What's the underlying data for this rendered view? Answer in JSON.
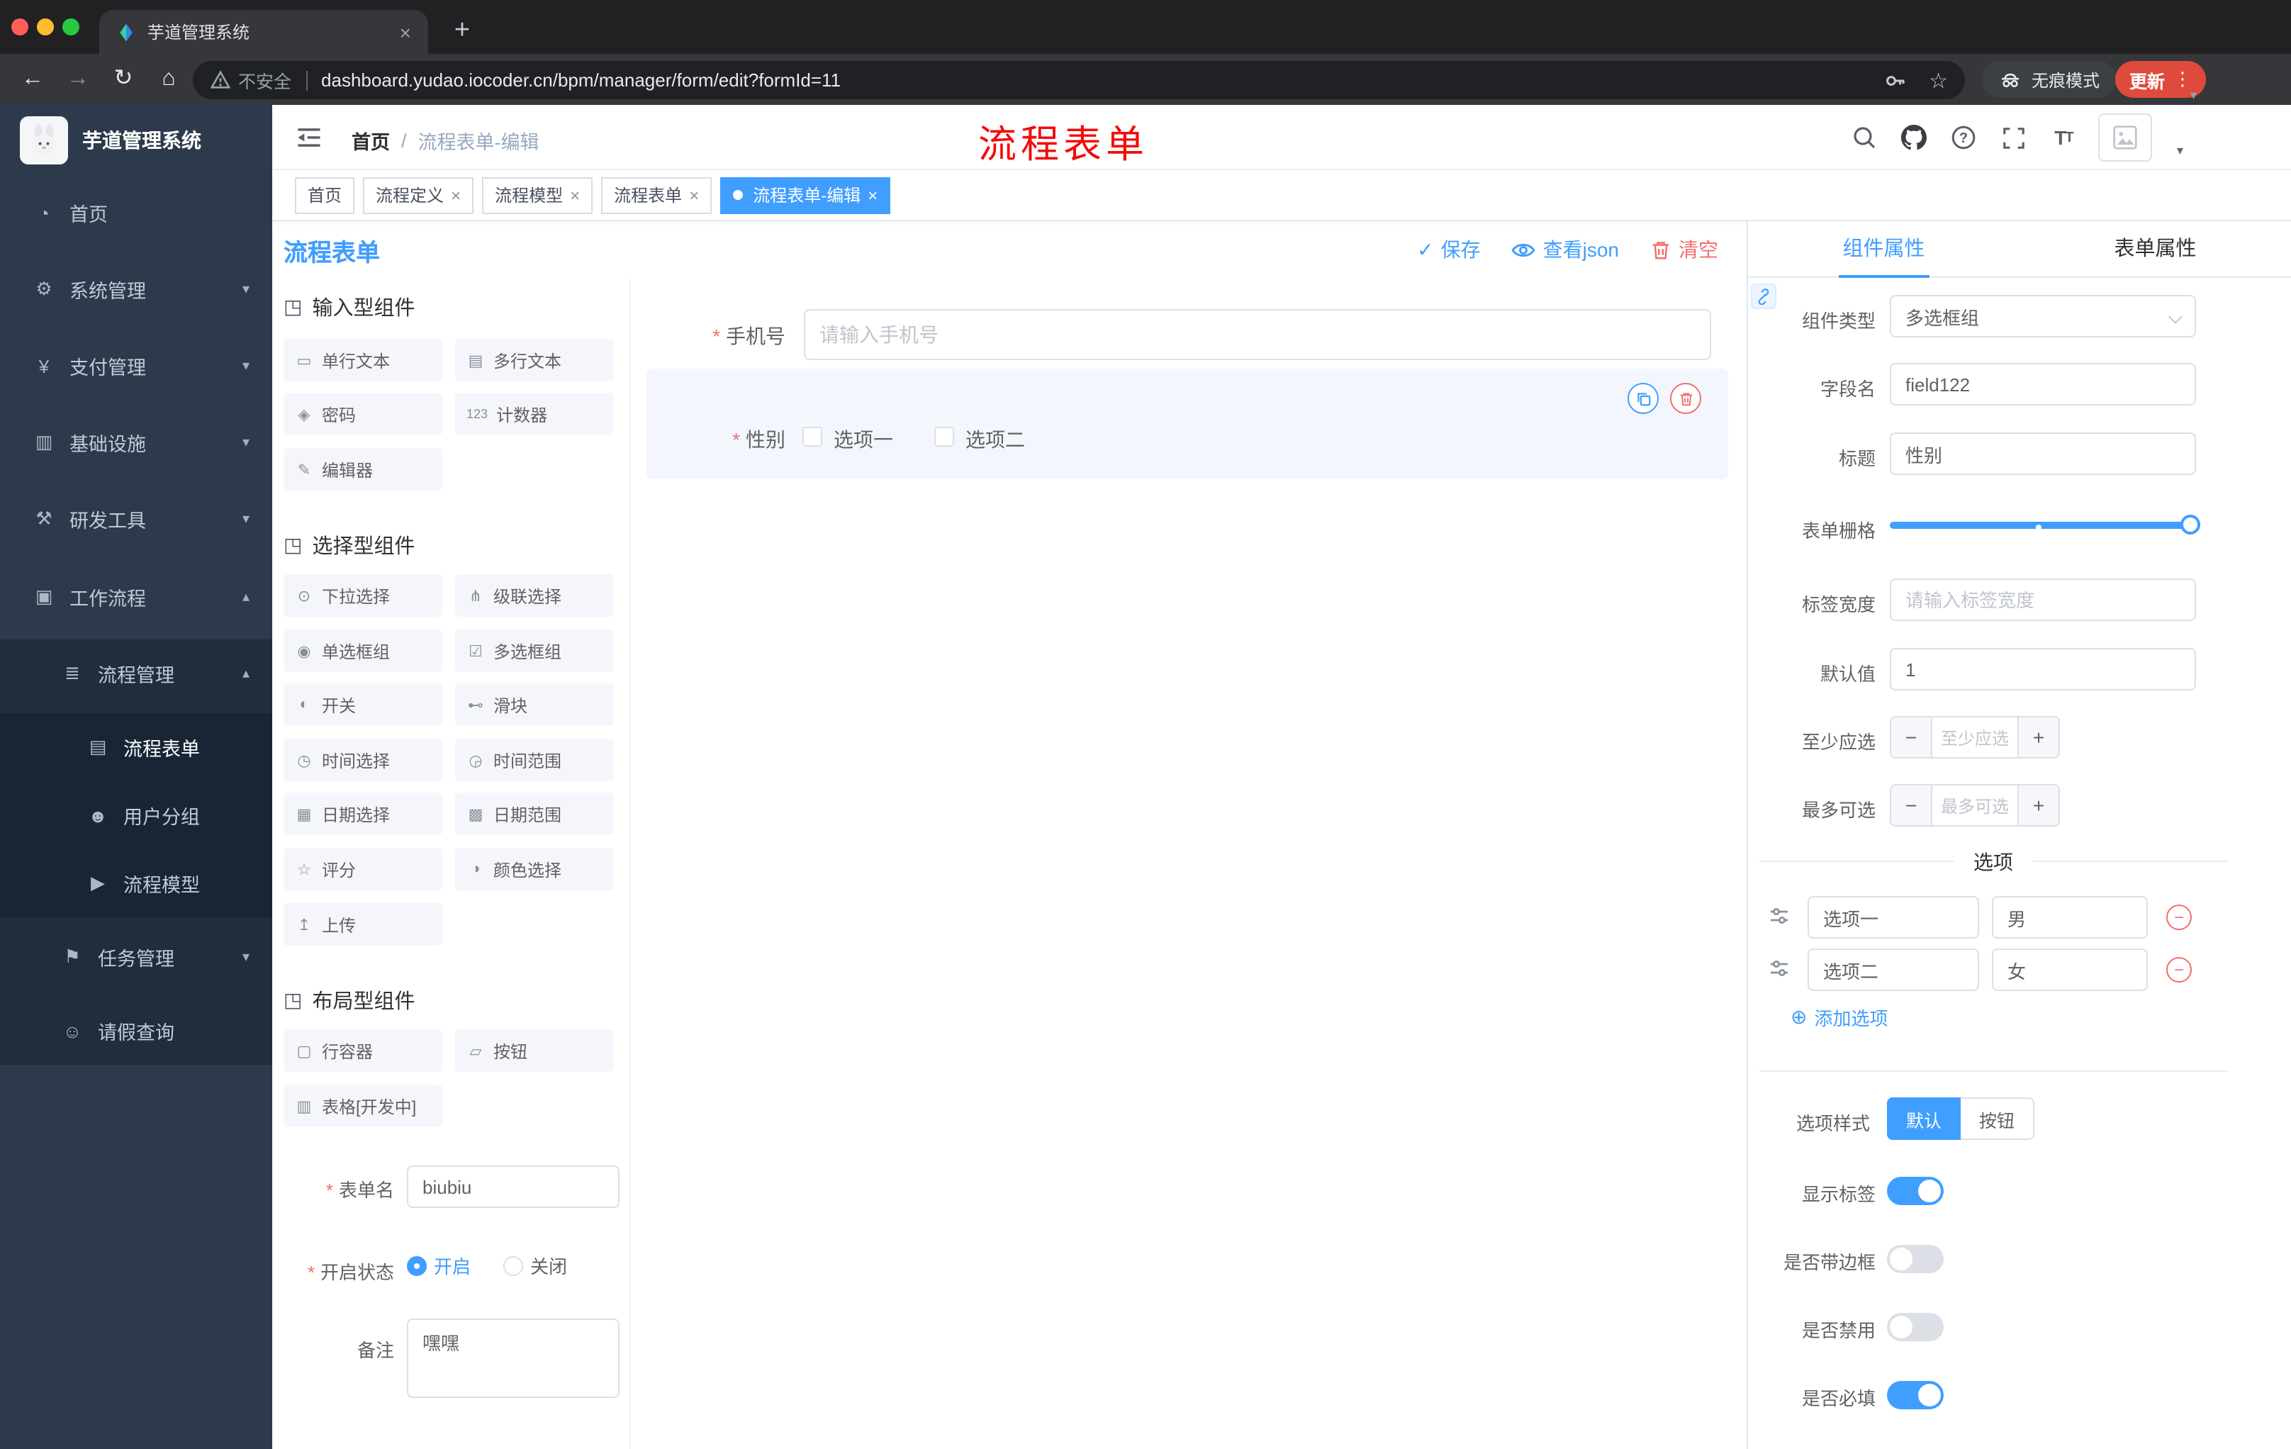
{
  "browser": {
    "tab_title": "芋道管理系统",
    "security_label": "不安全",
    "url": "dashboard.yudao.iocoder.cn/bpm/manager/form/edit?formId=11",
    "incognito_label": "无痕模式",
    "update_label": "更新"
  },
  "annotation": {
    "text": "流程表单"
  },
  "sidebar": {
    "logo_title": "芋道管理系统",
    "items": [
      {
        "label": "首页",
        "icon": "dashboard",
        "level": 1
      },
      {
        "label": "系统管理",
        "icon": "gear",
        "level": 1,
        "chevron": "chevron-down"
      },
      {
        "label": "支付管理",
        "icon": "yen",
        "level": 1,
        "chevron": "chevron-down"
      },
      {
        "label": "基础设施",
        "icon": "infra",
        "level": 1,
        "chevron": "chevron-down"
      },
      {
        "label": "研发工具",
        "icon": "tools",
        "level": 1,
        "chevron": "chevron-down"
      },
      {
        "label": "工作流程",
        "icon": "workflow",
        "level": 1,
        "chevron": "chevron-up"
      },
      {
        "label": "流程管理",
        "icon": "process",
        "level": 2,
        "chevron": "chevron-up"
      },
      {
        "label": "流程表单",
        "icon": "form",
        "level": 3,
        "active": true
      },
      {
        "label": "用户分组",
        "icon": "users",
        "level": 3
      },
      {
        "label": "流程模型",
        "icon": "model",
        "level": 3
      },
      {
        "label": "任务管理",
        "icon": "task",
        "level": 2,
        "chevron": "chevron-down"
      },
      {
        "label": "请假查询",
        "icon": "user",
        "level": 2
      }
    ]
  },
  "header": {
    "breadcrumb": [
      "首页",
      "流程表单-编辑"
    ],
    "breadcrumb_sep": "/"
  },
  "tags": [
    {
      "label": "首页"
    },
    {
      "label": "流程定义",
      "closable": true
    },
    {
      "label": "流程模型",
      "closable": true
    },
    {
      "label": "流程表单",
      "closable": true
    },
    {
      "label": "流程表单-编辑",
      "closable": true,
      "active": true
    }
  ],
  "designer": {
    "title": "流程表单",
    "actions": {
      "save": "保存",
      "view_json": "查看json",
      "clear": "清空"
    },
    "palette": {
      "sections": [
        {
          "title": "输入型组件",
          "icon": "component",
          "items": [
            {
              "label": "单行文本",
              "icon": "text-field"
            },
            {
              "label": "多行文本",
              "icon": "textarea"
            },
            {
              "label": "密码",
              "icon": "lock"
            },
            {
              "label": "计数器",
              "icon": "counter"
            },
            {
              "label": "编辑器",
              "icon": "editor"
            }
          ]
        },
        {
          "title": "选择型组件",
          "icon": "component",
          "items": [
            {
              "label": "下拉选择",
              "icon": "select"
            },
            {
              "label": "级联选择",
              "icon": "cascader"
            },
            {
              "label": "单选框组",
              "icon": "radio-group"
            },
            {
              "label": "多选框组",
              "icon": "checkbox-group"
            },
            {
              "label": "开关",
              "icon": "switch"
            },
            {
              "label": "滑块",
              "icon": "slider"
            },
            {
              "label": "时间选择",
              "icon": "time"
            },
            {
              "label": "时间范围",
              "icon": "time-range"
            },
            {
              "label": "日期选择",
              "icon": "date"
            },
            {
              "label": "日期范围",
              "icon": "date-range"
            },
            {
              "label": "评分",
              "icon": "rate"
            },
            {
              "label": "颜色选择",
              "icon": "color"
            },
            {
              "label": "上传",
              "icon": "upload"
            }
          ]
        },
        {
          "title": "布局型组件",
          "icon": "component",
          "items": [
            {
              "label": "行容器",
              "icon": "row"
            },
            {
              "label": "按钮",
              "icon": "button"
            },
            {
              "label": "表格[开发中]",
              "icon": "table"
            }
          ]
        }
      ]
    },
    "meta": {
      "form_name_label": "表单名",
      "form_name_value": "biubiu",
      "status_label": "开启状态",
      "status_on": "开启",
      "status_off": "关闭",
      "remark_label": "备注",
      "remark_value": "嘿嘿"
    },
    "canvas": {
      "phone_label": "手机号",
      "phone_placeholder": "请输入手机号",
      "gender_label": "性别",
      "gender_options": [
        "选项一",
        "选项二"
      ]
    }
  },
  "panel": {
    "tabs": [
      "组件属性",
      "表单属性"
    ],
    "component_type_label": "组件类型",
    "component_type_value": "多选框组",
    "field_name_label": "字段名",
    "field_name_value": "field122",
    "title_label": "标题",
    "title_value": "性别",
    "grid_label": "表单栅格",
    "label_width_label": "标签宽度",
    "label_width_placeholder": "请输入标签宽度",
    "default_label": "默认值",
    "default_value": "1",
    "min_label": "至少应选",
    "min_placeholder": "至少应选",
    "max_label": "最多可选",
    "max_placeholder": "最多可选",
    "options_title": "选项",
    "options": [
      {
        "label": "选项一",
        "value": "男"
      },
      {
        "label": "选项二",
        "value": "女"
      }
    ],
    "add_option": "添加选项",
    "option_style_label": "选项样式",
    "style_default": "默认",
    "style_button": "按钮",
    "toggles": [
      {
        "label": "显示标签",
        "on": true
      },
      {
        "label": "是否带边框",
        "on": false
      },
      {
        "label": "是否禁用",
        "on": false
      },
      {
        "label": "是否必填",
        "on": true
      }
    ]
  },
  "colors": {
    "accent": "#409EFF",
    "danger": "#F56C6C"
  }
}
